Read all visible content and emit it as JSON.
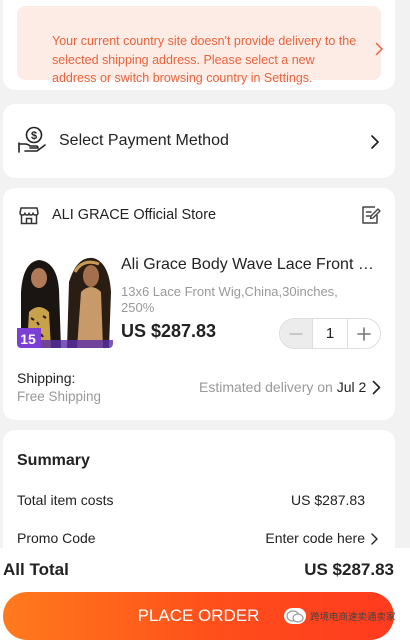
{
  "warning": {
    "text": "Your current country site doesn't provide delivery to the selected shipping address. Please select a new address or switch browsing country in Settings."
  },
  "payment": {
    "label": "Select Payment Method"
  },
  "store": {
    "name": "ALI GRACE Official Store",
    "product": {
      "title": "Ali Grace Body Wave Lace Front Wig...",
      "spec": "13x6 Lace Front Wig,China,30inches, 250%",
      "price": "US $287.83",
      "quantity": "1",
      "image_badge": "15"
    },
    "shipping": {
      "label": "Shipping:",
      "method": "Free Shipping",
      "estimate_prefix": "Estimated delivery on ",
      "estimate_date": "Jul 2"
    }
  },
  "summary": {
    "title": "Summary",
    "total_item_label": "Total item costs",
    "total_item_value": "US $287.83",
    "promo_label": "Promo Code",
    "promo_value": "Enter code here"
  },
  "footer": {
    "all_total_label": "All Total",
    "all_total_value": "US $287.83",
    "place_order": "PLACE ORDER",
    "watermark": "跨境电商速卖通卖家"
  },
  "colors": {
    "warning_text": "#e8643c",
    "warning_bg": "#fdece6",
    "button_start": "#ff7a1c",
    "button_end": "#ff3b1f"
  }
}
